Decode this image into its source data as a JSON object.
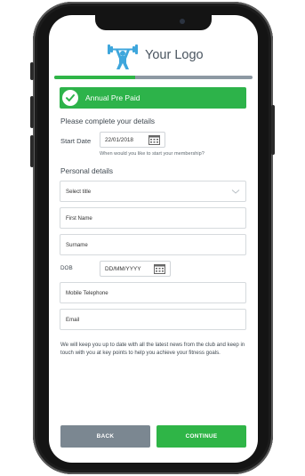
{
  "brand": {
    "logo_text": "Your Logo",
    "accent": "#2fb547",
    "logo_color": "#3ea6dc"
  },
  "progress": {
    "fraction": 0.41
  },
  "plan": {
    "label": "Annual Pre Paid",
    "icon": "check-icon"
  },
  "membership": {
    "heading": "Please complete your details",
    "start_date_label": "Start Date",
    "start_date_value": "22/01/2018",
    "start_date_hint": "When would you like to start your membership?"
  },
  "personal": {
    "heading": "Personal details",
    "title_select": "Select title",
    "first_name_placeholder": "First Name",
    "surname_placeholder": "Surname",
    "dob_label": "DOB",
    "dob_placeholder": "DD/MM/YYYY",
    "mobile_placeholder": "Mobile Telephone",
    "email_placeholder": "Email"
  },
  "info_text": "We will keep you up to date with all the latest news from the club and keep in touch with you at key points to help you achieve your fitness goals.",
  "buttons": {
    "back": "BACK",
    "continue": "CONTINUE"
  }
}
